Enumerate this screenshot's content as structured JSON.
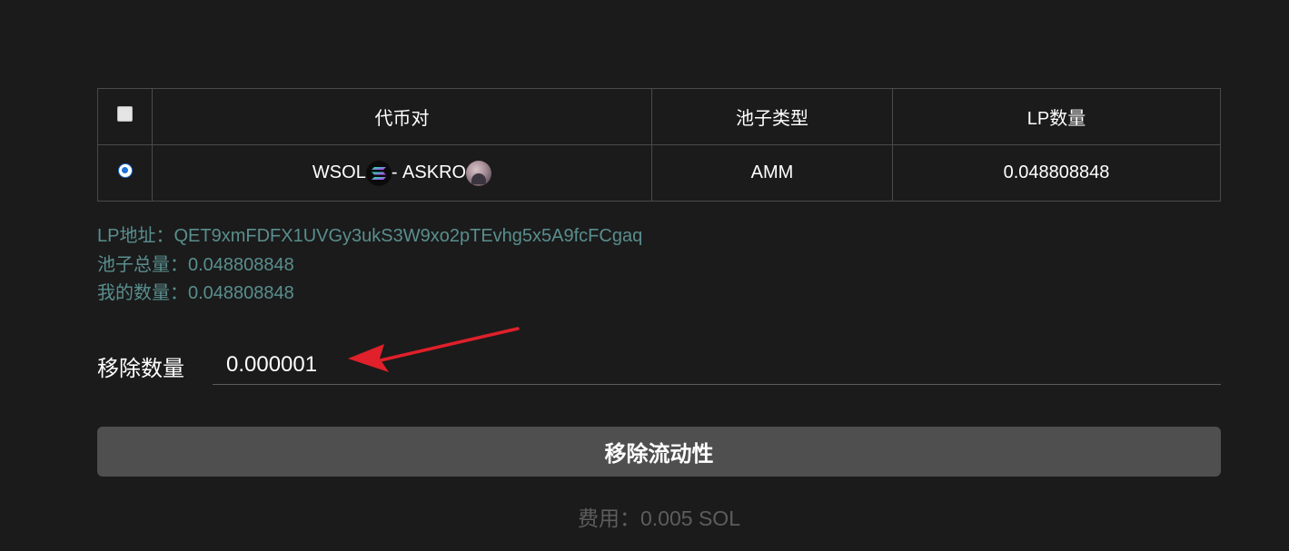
{
  "table": {
    "headers": {
      "pair": "代币对",
      "pool_type": "池子类型",
      "lp_amount": "LP数量"
    },
    "rows": [
      {
        "token_a": "WSOL",
        "token_a_icon": "solana-icon",
        "separator": "- ",
        "token_b": "ASKRO",
        "token_b_icon": "askro-token-icon",
        "pool_type": "AMM",
        "lp_amount": "0.048808848",
        "selected": true
      }
    ]
  },
  "info": {
    "lp_address": "LP地址：QET9xmFDFX1UVGy3ukS3W9xo2pTEvhg5x5A9fcFCgaq",
    "pool_total": "池子总量：0.048808848",
    "my_amount": "我的数量：0.048808848"
  },
  "remove": {
    "label": "移除数量",
    "value": "0.000001"
  },
  "button": {
    "label": "移除流动性"
  },
  "fee": {
    "text": "费用：0.005 SOL"
  },
  "colors": {
    "background": "#1b1b1b",
    "info_text": "#5a8e8e",
    "button_bg": "#4f4f4f",
    "annotation_arrow": "#e0202a",
    "radio_accent": "#1e71d8"
  }
}
